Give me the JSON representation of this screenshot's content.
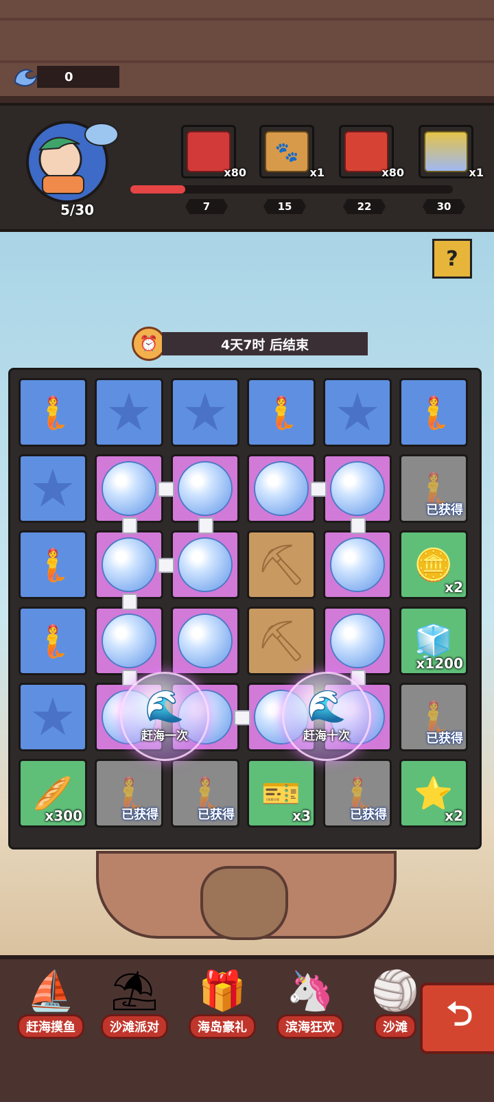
{
  "currency": {
    "icon": "wave-icon",
    "count": "0"
  },
  "progress": {
    "avatar_count": "5/30",
    "fill_fraction": 0.05,
    "rewards": [
      {
        "icon": "red-treasure-chest-icon",
        "qty": "x80",
        "color": "#d23a3a",
        "milestone": "7"
      },
      {
        "icon": "paw-crate-icon",
        "qty": "x1",
        "color": "#d79a4a",
        "milestone": "15"
      },
      {
        "icon": "red-gift-box-icon",
        "qty": "x80",
        "color": "#d64335",
        "milestone": "22"
      },
      {
        "icon": "crystal-gift-box-icon",
        "qty": "x1",
        "color": "#e4c24a",
        "milestone": "30"
      }
    ]
  },
  "help": {
    "label": "?"
  },
  "timer": {
    "text": "4天7时 后结束"
  },
  "board": {
    "obtained_label": "已获得",
    "rows": [
      [
        "character",
        "star",
        "star",
        "character",
        "star",
        "character"
      ],
      [
        "star",
        "bubble",
        "bubble",
        "bubble",
        "bubble",
        "character-obtained"
      ],
      [
        "character",
        "bubble",
        "bubble",
        "shovel",
        "bubble",
        "gold-coin"
      ],
      [
        "character",
        "bubble",
        "bubble",
        "shovel",
        "bubble",
        "ice-cubes"
      ],
      [
        "star",
        "bubble",
        "bubble",
        "bubble",
        "bubble",
        "character-obtained"
      ],
      [
        "bread",
        "character-obtained",
        "character-obtained",
        "ticket",
        "character-obtained",
        "star-coin"
      ]
    ],
    "rewards": {
      "gold-coin": "x2",
      "ice-cubes": "x1200",
      "bread": "x300",
      "ticket": "x3",
      "star-coin": "x2"
    },
    "actions": [
      {
        "label": "赶海一次"
      },
      {
        "label": "赶海十次"
      }
    ]
  },
  "nav": {
    "items": [
      {
        "label": "赶海摸鱼",
        "icon": "fishing-boat-icon"
      },
      {
        "label": "沙滩派对",
        "icon": "beach-umbrella-icon"
      },
      {
        "label": "海岛豪礼",
        "icon": "treasure-chest-icon"
      },
      {
        "label": "滨海狂欢",
        "icon": "mermaid-unicorn-icon"
      },
      {
        "label": "沙滩",
        "icon": "beach-ball-icon"
      }
    ],
    "next_icon": "arrow-switch-icon"
  }
}
